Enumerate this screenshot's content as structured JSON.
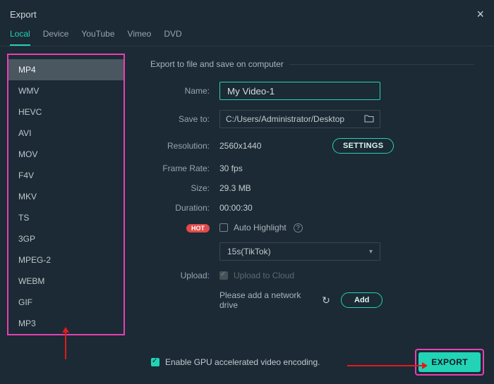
{
  "window": {
    "title": "Export"
  },
  "tabs": {
    "items": [
      "Local",
      "Device",
      "YouTube",
      "Vimeo",
      "DVD"
    ],
    "active": 0
  },
  "formats": {
    "items": [
      "MP4",
      "WMV",
      "HEVC",
      "AVI",
      "MOV",
      "F4V",
      "MKV",
      "TS",
      "3GP",
      "MPEG-2",
      "WEBM",
      "GIF",
      "MP3"
    ],
    "active": 0
  },
  "section": {
    "title": "Export to file and save on computer"
  },
  "fields": {
    "name_label": "Name:",
    "name_value": "My Video-1",
    "saveto_label": "Save to:",
    "saveto_value": "C:/Users/Administrator/Desktop",
    "resolution_label": "Resolution:",
    "resolution_value": "2560x1440",
    "framerate_label": "Frame Rate:",
    "framerate_value": "30 fps",
    "size_label": "Size:",
    "size_value": "29.3 MB",
    "duration_label": "Duration:",
    "duration_value": "00:00:30",
    "autohighlight_label": "Auto Highlight",
    "hot_badge": "HOT",
    "preset_value": "15s(TikTok)",
    "upload_label": "Upload:",
    "upload_value": "Upload to Cloud",
    "network_drive_msg": "Please add a network drive"
  },
  "buttons": {
    "settings": "SETTINGS",
    "add": "Add",
    "export": "EXPORT"
  },
  "footer": {
    "gpu_label": "Enable GPU accelerated video encoding."
  }
}
